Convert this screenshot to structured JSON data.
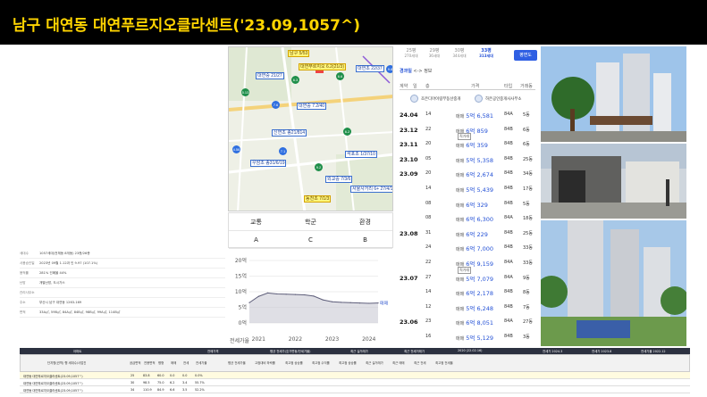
{
  "title": "남구 대연동 대연푸르지오클라센트('23.09,1057^)",
  "map": {
    "labels": [
      {
        "text": "남구 5/53",
        "style": "y"
      },
      {
        "text": "대연푸르지오 6.2(21/3)",
        "style": "y"
      },
      {
        "text": "대연초 22/37",
        "style": "b"
      },
      {
        "text": "대연중 21/27",
        "style": "b"
      },
      {
        "text": "대연중 7.2/40",
        "style": "b"
      },
      {
        "text": "신연초 종21/814",
        "style": "b"
      },
      {
        "text": "우암초 종31/6/19",
        "style": "b"
      },
      {
        "text": "석포초 1/37/10",
        "style": "b"
      },
      {
        "text": "동천초 7/1/3",
        "style": "y"
      },
      {
        "text": "외교중 7/3/6",
        "style": "b"
      },
      {
        "text": "서울사거리 6+ 27/4/18",
        "style": "b"
      }
    ],
    "dots": [
      "6.3",
      "6.6",
      "5.13",
      "7.6",
      "4.58",
      "9.2",
      "9.8",
      "6.2",
      "7.1"
    ]
  },
  "grade": {
    "headers": [
      "교통",
      "학군",
      "환경"
    ],
    "values": [
      "A",
      "C",
      "B"
    ]
  },
  "graph": {
    "yticks": [
      "20억",
      "15억",
      "10억",
      "5억",
      "0억"
    ],
    "xticks": [
      "2021",
      "2022",
      "2023",
      "2024"
    ],
    "legend": "전세가율",
    "end_label": "매매"
  },
  "chart_data": {
    "type": "area",
    "x": [
      "2020-10",
      "2021-01",
      "2021-04",
      "2021-07",
      "2021-10",
      "2022-01",
      "2022-04",
      "2022-07",
      "2022-10",
      "2023-01",
      "2023-04",
      "2023-07",
      "2023-10",
      "2024-01",
      "2024-04"
    ],
    "series": [
      {
        "name": "매매",
        "values": [
          6.5,
          8.5,
          9.6,
          9.3,
          9.2,
          9.1,
          9.0,
          8.6,
          7.4,
          6.8,
          6.6,
          6.5,
          6.4,
          6.3,
          6.4
        ]
      }
    ],
    "ylim": [
      0,
      20
    ]
  },
  "info": {
    "rows": [
      {
        "k": "세대수",
        "v": "1057세대(전체동 8개동)  23층/26층"
      },
      {
        "k": "사용승인일",
        "v": "2023년 09월  1.12과 인 9.97 (107.1%)"
      },
      {
        "k": "용적률",
        "v": "281%  건폐율 44%"
      },
      {
        "k": "난방",
        "v": "개별난방, 도시가스"
      },
      {
        "k": "관리사무소",
        "v": ""
      },
      {
        "k": "주소",
        "v": "부산시 남구 대연동 1263-169"
      },
      {
        "k": "면적",
        "v": "33A㎡, 59B㎡, 84A㎡, 84B㎡, 98B㎡, 99A㎡, 114B㎡"
      }
    ]
  },
  "listing": {
    "tabs": [
      {
        "label": "25평",
        "sub": "270세대"
      },
      {
        "label": "29평",
        "sub": "36세대"
      },
      {
        "label": "30평",
        "sub": "344세대"
      },
      {
        "label": "33평",
        "sub": "313세대"
      }
    ],
    "map_button": "평면도",
    "selector": {
      "active": "경과일",
      "sep": "<->",
      "other": "정보"
    },
    "headers": [
      "계약",
      "일",
      "층",
      "가격",
      "타입",
      "거래동"
    ],
    "agents": [
      "조은디아이링부동산중개",
      "하은공인중개사사무소"
    ],
    "rows": [
      {
        "ym": "24.04",
        "fl": "14",
        "kind": "매매",
        "price": "5억 6,581",
        "type": "84A",
        "dong": "5동"
      },
      {
        "ym": "23.12",
        "fl": "22",
        "kind": "매매",
        "price": "6억 859",
        "type": "84B",
        "dong": "6동"
      },
      {
        "ym": "23.11",
        "fl": "20",
        "kind": "매매",
        "price": "6억 359",
        "type": "84B",
        "dong": "6동",
        "badge": "직거래"
      },
      {
        "ym": "23.10",
        "fl": "05",
        "kind": "매매",
        "price": "5억 5,358",
        "type": "84B",
        "dong": "25동"
      },
      {
        "ym": "23.09",
        "fl": "20",
        "kind": "매매",
        "price": "6억 2,674",
        "type": "84B",
        "dong": "34동"
      },
      {
        "ym": "",
        "fl": "14",
        "kind": "매매",
        "price": "5억 5,439",
        "type": "84B",
        "dong": "17동"
      },
      {
        "ym": "",
        "fl": "08",
        "kind": "매매",
        "price": "6억 329",
        "type": "84B",
        "dong": "5동"
      },
      {
        "ym": "",
        "fl": "08",
        "kind": "매매",
        "price": "6억 6,300",
        "type": "84A",
        "dong": "18동"
      },
      {
        "ym": "23.08",
        "fl": "31",
        "kind": "매매",
        "price": "6억 229",
        "type": "84B",
        "dong": "25동"
      },
      {
        "ym": "",
        "fl": "24",
        "kind": "매매",
        "price": "6억 7,000",
        "type": "84B",
        "dong": "33동"
      },
      {
        "ym": "",
        "fl": "22",
        "kind": "매매",
        "price": "6억 9,159",
        "type": "84A",
        "dong": "33동"
      },
      {
        "ym": "23.07",
        "fl": "27",
        "kind": "매매",
        "price": "5억 7,079",
        "type": "84A",
        "dong": "9동",
        "badge": "직거래"
      },
      {
        "ym": "",
        "fl": "14",
        "kind": "매매",
        "price": "6억 2,178",
        "type": "84B",
        "dong": "8동"
      },
      {
        "ym": "",
        "fl": "12",
        "kind": "매매",
        "price": "5억 6,248",
        "type": "84B",
        "dong": "7동"
      },
      {
        "ym": "23.06",
        "fl": "23",
        "kind": "매매",
        "price": "6억 8,051",
        "type": "84A",
        "dong": "27동"
      },
      {
        "ym": "",
        "fl": "16",
        "kind": "매매",
        "price": "5억 5,129",
        "type": "84B",
        "dong": "3동"
      }
    ]
  },
  "bottom_table": {
    "top_headers": [
      "아파트",
      "전매가격",
      "평균 전세가(호가변동/전세가율)",
      "최근 실거래가",
      "최근 전세거래가",
      "2020 (22.02.16)",
      "전세가 2024.3",
      "전세가 2023.8",
      "전세가율 2022.12"
    ],
    "sub_headers": [
      "단지명(권역) 행 세대수/사업진",
      "공급면적",
      "전용면적",
      "평형",
      "매매",
      "전세",
      "전세가율",
      "평균 전세가율",
      "고점대비 하락률",
      "최고점 상승률",
      "최고점 수익률",
      "최고점 상승률",
      "최근 실거래가",
      "최근 매매",
      "최근 전세",
      "최고점 전세율"
    ],
    "rows": [
      {
        "name": "대연동 대연푸르지오클라센트(23.09,1057^)",
        "area": "25",
        "exc": "83.8",
        "py": "60.0",
        "sale": "0.0",
        "jeon": "0.0",
        "rate": "0.0%"
      },
      {
        "name": "대연동 대연푸르지오클라센트(23.09,1057^)",
        "area": "30",
        "exc": "98.5",
        "py": "75.0",
        "sale": "6.2",
        "jeon": "3.4",
        "rate": "55.7%"
      },
      {
        "name": "대연동 대연푸르지오클라센트(23.09,1057^)",
        "area": "34",
        "exc": "110.9",
        "py": "84.9",
        "sale": "6.6",
        "jeon": "3.5",
        "rate": "52.2%"
      }
    ]
  }
}
